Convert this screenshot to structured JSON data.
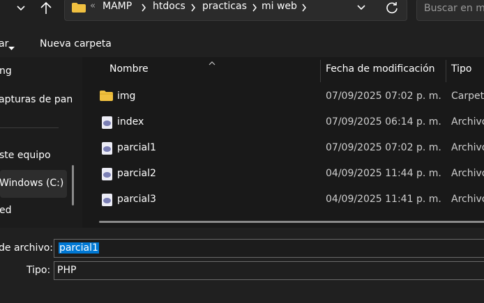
{
  "header": {
    "breadcrumb": [
      "MAMP",
      "htdocs",
      "practicas",
      "mi web"
    ],
    "overflow_glyph": "«",
    "search_placeholder": "Buscar en mi"
  },
  "toolbar": {
    "organize_label": "ar",
    "new_folder_label": "Nueva carpeta"
  },
  "nav": {
    "items": [
      {
        "label": "ng"
      },
      {
        "label": "apturas de pan"
      },
      {
        "label": "ste equipo"
      },
      {
        "label": "Windows (C:)",
        "selected": true
      },
      {
        "label": "ed"
      }
    ]
  },
  "columns": {
    "name": "Nombre",
    "modified": "Fecha de modificación",
    "type": "Tipo"
  },
  "files": [
    {
      "name": "img",
      "date": "07/09/2025 07:02 p. m.",
      "type": "Carpeta",
      "icon": "folder-icon"
    },
    {
      "name": "index",
      "date": "07/09/2025 06:14 p. m.",
      "type": "Archivo",
      "icon": "php-file-icon"
    },
    {
      "name": "parcial1",
      "date": "07/09/2025 07:02 p. m.",
      "type": "Archivo",
      "icon": "php-file-icon"
    },
    {
      "name": "parcial2",
      "date": "04/09/2025 11:44 p. m.",
      "type": "Archivo",
      "icon": "php-file-icon"
    },
    {
      "name": "parcial3",
      "date": "04/09/2025 11:41 p. m.",
      "type": "Archivo",
      "icon": "php-file-icon"
    }
  ],
  "save": {
    "filename_label": "de archivo:",
    "filename_value": "parcial1",
    "type_label": "Tipo:",
    "type_value": "PHP"
  },
  "colors": {
    "selection": "#0078d4",
    "folder": "#f0c040"
  }
}
